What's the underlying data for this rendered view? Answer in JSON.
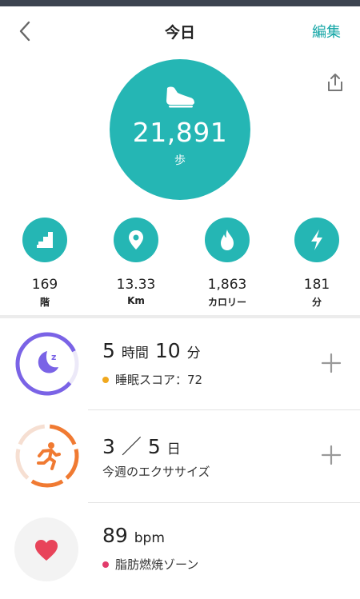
{
  "header": {
    "title": "今日",
    "edit_label": "編集"
  },
  "steps": {
    "value": "21,891",
    "unit": "歩"
  },
  "stats": [
    {
      "value": "169",
      "unit": "階",
      "icon": "stairs-icon"
    },
    {
      "value": "13.33",
      "unit": "Km",
      "icon": "location-pin-icon"
    },
    {
      "value": "1,863",
      "unit": "カロリー",
      "icon": "flame-icon"
    },
    {
      "value": "181",
      "unit": "分",
      "icon": "lightning-icon"
    }
  ],
  "sleep": {
    "hours": "5",
    "hours_unit": "時間",
    "minutes": "10",
    "minutes_unit": "分",
    "score_label": "睡眠スコア：72",
    "dot_color": "#f0a81e",
    "ring_color": "#7a63e6"
  },
  "exercise": {
    "done": "3",
    "separator": "／",
    "goal": "5",
    "unit": "日",
    "label": "今週のエクササイズ",
    "ring_color": "#f07a32",
    "progress": 0.6
  },
  "heart": {
    "value": "89",
    "unit": "bpm",
    "zone_label": "脂肪燃焼ゾーン",
    "dot_color": "#e23b6b",
    "icon_color": "#e8445a"
  },
  "colors": {
    "accent": "#25b6b4",
    "edit": "#12a5a5"
  }
}
